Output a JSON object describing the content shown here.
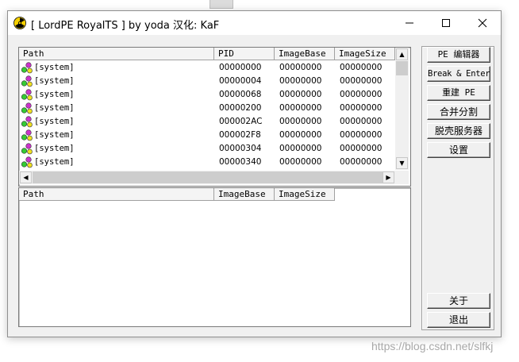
{
  "window": {
    "title": "[ LordPE RoyalTS ] by yoda 汉化: KaF",
    "icon": "radiation-icon",
    "controls": [
      "minimize-icon",
      "maximize-icon",
      "close-icon"
    ]
  },
  "process_list": {
    "columns": [
      "Path",
      "PID",
      "ImageBase",
      "ImageSize"
    ],
    "rows": [
      {
        "path": "[system]",
        "pid": "00000000",
        "image_base": "00000000",
        "image_size": "00000000"
      },
      {
        "path": "[system]",
        "pid": "00000004",
        "image_base": "00000000",
        "image_size": "00000000"
      },
      {
        "path": "[system]",
        "pid": "00000068",
        "image_base": "00000000",
        "image_size": "00000000"
      },
      {
        "path": "[system]",
        "pid": "00000200",
        "image_base": "00000000",
        "image_size": "00000000"
      },
      {
        "path": "[system]",
        "pid": "000002AC",
        "image_base": "00000000",
        "image_size": "00000000"
      },
      {
        "path": "[system]",
        "pid": "000002F8",
        "image_base": "00000000",
        "image_size": "00000000"
      },
      {
        "path": "[system]",
        "pid": "00000304",
        "image_base": "00000000",
        "image_size": "00000000"
      },
      {
        "path": "[system]",
        "pid": "00000340",
        "image_base": "00000000",
        "image_size": "00000000"
      }
    ]
  },
  "module_list": {
    "columns": [
      "Path",
      "ImageBase",
      "ImageSize"
    ],
    "rows": []
  },
  "side_buttons": {
    "pe_editor": "PE 编辑器",
    "break_enter": "Break & Enter",
    "rebuild_pe": "重建 PE",
    "merge_split": "合并分割",
    "unpacker_server": "脱壳服务器",
    "settings": "设置",
    "about": "关于",
    "exit": "退出"
  },
  "watermark": "https://blog.csdn.net/slfkj",
  "colors": {
    "process_icon_magenta": "#cc33cc",
    "process_icon_green": "#33cc33",
    "process_icon_yellow": "#f0e020"
  }
}
